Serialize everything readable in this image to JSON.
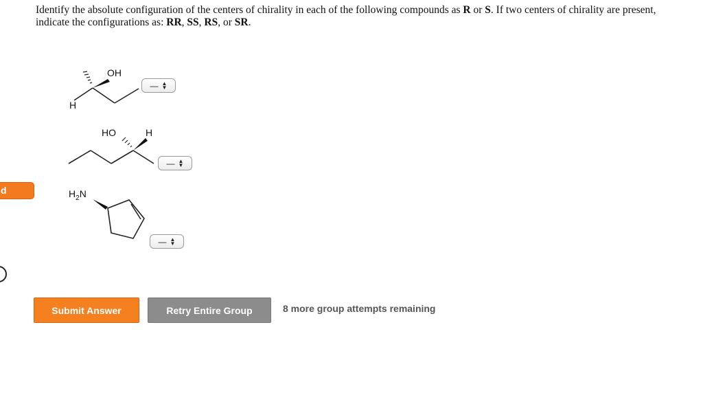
{
  "question": {
    "part1": "Identify the absolute configuration of the centers of chirality in each of the following compounds as ",
    "r": "R",
    "or1": " or ",
    "s": "S",
    "part2": ". If two centers of chirality are present, indicate the configurations as: ",
    "rr": "RR",
    "sep1": ", ",
    "ss": "SS",
    "sep2": ", ",
    "rs": "RS",
    "sep3": ", or ",
    "sr": "SR",
    "end": "."
  },
  "side_tab": {
    "label": "d"
  },
  "molecules": [
    {
      "labels": {
        "oh": "OH",
        "h": "H"
      },
      "select": {
        "value": "—"
      }
    },
    {
      "labels": {
        "ho": "HO",
        "h": "H"
      },
      "select": {
        "value": "—"
      }
    },
    {
      "labels": {
        "h2n_h": "H",
        "h2n_sub": "2",
        "h2n_n": "N"
      },
      "select": {
        "value": "—"
      }
    }
  ],
  "icons": {
    "select_arrows": "updown-arrows-icon"
  },
  "buttons": {
    "submit": "Submit Answer",
    "retry": "Retry Entire Group"
  },
  "attempts": "8 more group attempts remaining",
  "colors": {
    "submit": "#f58020",
    "retry": "#8c8c8c",
    "side_tab": "#f47a20"
  }
}
